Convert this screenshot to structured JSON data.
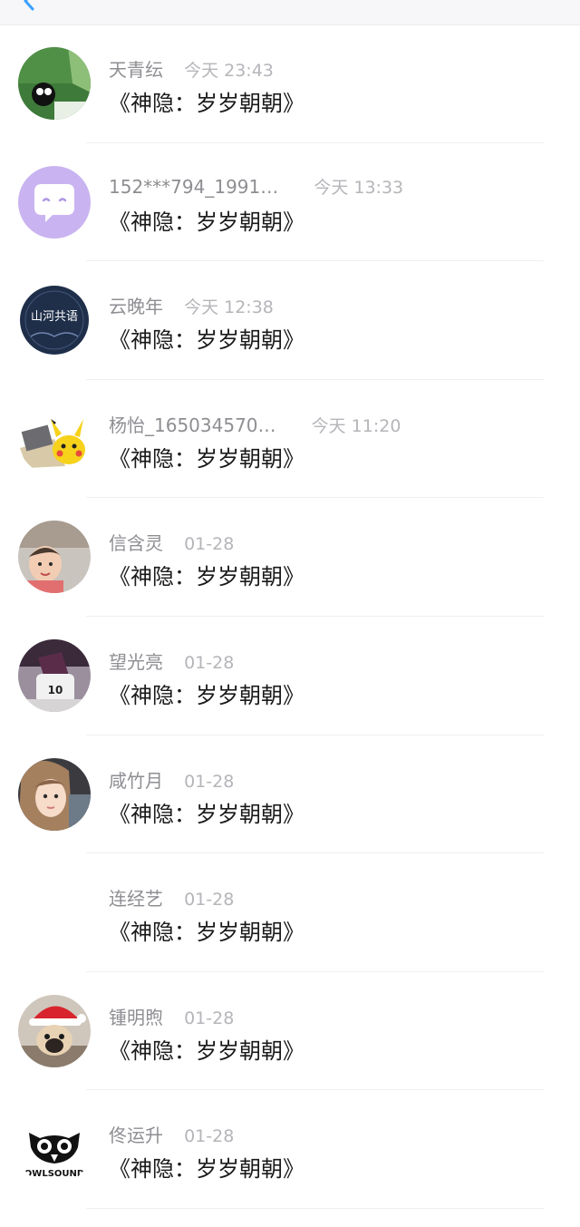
{
  "header": {
    "back_icon": "chevron-left-icon",
    "accent": "#3aa0ff"
  },
  "comments": [
    {
      "name": "天青纭",
      "time": "今天 23:43",
      "content": "《神隐：岁岁朝朝》",
      "avatar": "green-plant-character-avatar"
    },
    {
      "name": "152***794_1991…",
      "time": "今天 13:33",
      "content": "《神隐：岁岁朝朝》",
      "avatar": "purple-chat-bubble-avatar"
    },
    {
      "name": "云晚年",
      "time": "今天 12:38",
      "content": "《神隐：岁岁朝朝》",
      "avatar": "calligraphy-seal-avatar",
      "avatar_text": "山河共语"
    },
    {
      "name": "杨怡_165034570…",
      "time": "今天 11:20",
      "content": "《神隐：岁岁朝朝》",
      "avatar": "pikachu-avatar"
    },
    {
      "name": "信含灵",
      "time": "01-28",
      "content": "《神隐：岁岁朝朝》",
      "avatar": "child-photo-avatar"
    },
    {
      "name": "望光亮",
      "time": "01-28",
      "content": "《神隐：岁岁朝朝》",
      "avatar": "person-with-bag-avatar"
    },
    {
      "name": "咸竹月",
      "time": "01-28",
      "content": "《神隐：岁岁朝朝》",
      "avatar": "girl-selfie-avatar"
    },
    {
      "name": "连经艺",
      "time": "01-28",
      "content": "《神隐：岁岁朝朝》",
      "avatar": "blank-avatar"
    },
    {
      "name": "锺明煦",
      "time": "01-28",
      "content": "《神隐：岁岁朝朝》",
      "avatar": "pug-santa-hat-avatar"
    },
    {
      "name": "佟运升",
      "time": "01-28",
      "content": "《神隐：岁岁朝朝》",
      "avatar": "owlsound-logo-avatar",
      "avatar_text": "OWLSOUND"
    }
  ]
}
